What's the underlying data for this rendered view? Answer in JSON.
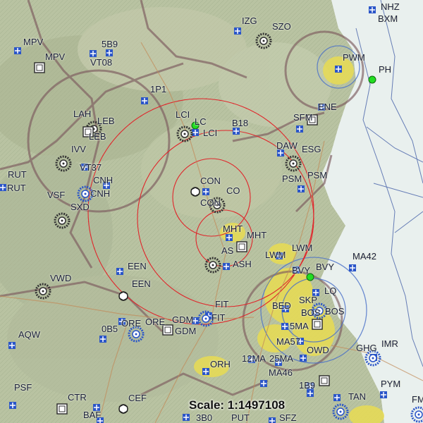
{
  "scale_text": "Scale: 1:1497108",
  "colors": {
    "terrain": "#b9c3a2",
    "water": "#e9f0ee",
    "range_rings": "#e0262b",
    "airspace": "#7c5a5e",
    "airport_blue": "#2a55c8",
    "waypoint_green": "#22dd22",
    "urban": "#e8dc52"
  },
  "airports": [
    {
      "id": "mpv",
      "symbol": "towered-airport-icon",
      "label": "MPV"
    },
    {
      "id": "5b9",
      "symbol": "towered-airport-icon",
      "label": "5B9"
    },
    {
      "id": "vt08",
      "symbol": "towered-airport-icon",
      "label": "VT08"
    },
    {
      "id": "1p1",
      "symbol": "towered-airport-icon",
      "label": "1P1"
    },
    {
      "id": "izg",
      "symbol": "towered-airport-icon",
      "label": "IZG"
    },
    {
      "id": "nhz",
      "symbol": "towered-airport-icon",
      "label": "NHZ"
    },
    {
      "id": "pwm",
      "symbol": "towered-airport-icon",
      "label": "PWM"
    },
    {
      "id": "b18",
      "symbol": "towered-airport-icon",
      "label": "B18"
    },
    {
      "id": "lci",
      "symbol": "towered-airport-icon",
      "label": "LCI"
    },
    {
      "id": "sfm",
      "symbol": "towered-airport-icon",
      "label": "SFM"
    },
    {
      "id": "dawesg",
      "symbol": "towered-airport-icon",
      "label": "ESG"
    },
    {
      "id": "vt37",
      "symbol": "towered-airport-icon",
      "label": "VT37"
    },
    {
      "id": "cnh",
      "symbol": "towered-airport-icon",
      "label": "CNH"
    },
    {
      "id": "rut",
      "symbol": "towered-airport-icon",
      "label": "RUT"
    },
    {
      "id": "con",
      "symbol": "towered-airport-icon",
      "label": "CON"
    },
    {
      "id": "psm",
      "symbol": "towered-airport-icon",
      "label": "PSM"
    },
    {
      "id": "mht",
      "symbol": "towered-airport-icon",
      "label": "MHT"
    },
    {
      "id": "ash",
      "symbol": "towered-airport-icon",
      "label": "ASH"
    },
    {
      "id": "lwm",
      "symbol": "towered-airport-icon",
      "label": "LWM"
    },
    {
      "id": "ma42",
      "symbol": "towered-airport-icon",
      "label": "MA42"
    },
    {
      "id": "bvy",
      "symbol": "towered-airport-icon",
      "label": "BVY"
    },
    {
      "id": "een",
      "symbol": "towered-airport-icon",
      "label": "EEN"
    },
    {
      "id": "fit",
      "symbol": "towered-airport-icon",
      "label": "FIT"
    },
    {
      "id": "gdm",
      "symbol": "towered-airport-icon",
      "label": "GDM"
    },
    {
      "id": "ore",
      "symbol": "towered-airport-icon",
      "label": "ORE"
    },
    {
      "id": "0b5",
      "symbol": "towered-airport-icon",
      "label": "0B5"
    },
    {
      "id": "aqw",
      "symbol": "towered-airport-icon",
      "label": "AQW"
    },
    {
      "id": "orh",
      "symbol": "towered-airport-icon",
      "label": "ORH"
    },
    {
      "id": "ma57",
      "symbol": "towered-airport-icon",
      "label": "MA57"
    },
    {
      "id": "5ma",
      "symbol": "towered-airport-icon",
      "label": "5MA"
    },
    {
      "id": "owd",
      "symbol": "towered-airport-icon",
      "label": "OWD"
    },
    {
      "id": "12ma",
      "symbol": "towered-airport-icon",
      "label": "12MA"
    },
    {
      "id": "25ma",
      "symbol": "towered-airport-icon",
      "label": "25MA"
    },
    {
      "id": "ma46",
      "symbol": "towered-airport-icon",
      "label": "MA46"
    },
    {
      "id": "bos",
      "symbol": "towered-airport-icon",
      "label": "BOS"
    },
    {
      "id": "bed",
      "symbol": "towered-airport-icon",
      "label": "BED"
    },
    {
      "id": "psf",
      "symbol": "towered-airport-icon",
      "label": "PSF"
    },
    {
      "id": "ctr",
      "symbol": "towered-airport-icon",
      "label": "CTR"
    },
    {
      "id": "baf",
      "symbol": "towered-airport-icon",
      "label": "BAF"
    },
    {
      "id": "3b0",
      "symbol": "towered-airport-icon",
      "label": "3B0"
    },
    {
      "id": "put",
      "symbol": "towered-airport-icon",
      "label": "PUT"
    },
    {
      "id": "sfz",
      "symbol": "towered-airport-icon",
      "label": "SFZ"
    },
    {
      "id": "1b9",
      "symbol": "towered-airport-icon",
      "label": "1B9"
    },
    {
      "id": "tan",
      "symbol": "towered-airport-icon",
      "label": "TAN"
    },
    {
      "id": "pym",
      "symbol": "towered-airport-icon",
      "label": "PYM"
    },
    {
      "id": "imr",
      "symbol": "towered-airport-icon",
      "label": "IMR"
    },
    {
      "id": "ghg",
      "symbol": "towered-airport-icon",
      "label": "GHG"
    },
    {
      "id": "lq",
      "symbol": "towered-airport-icon",
      "label": "LQ"
    },
    {
      "id": "fm",
      "symbol": "towered-airport-icon",
      "label": "FM"
    }
  ],
  "labels": [
    {
      "id": "mpv1",
      "text": "MPV"
    },
    {
      "id": "mpv2",
      "text": "MPV"
    },
    {
      "id": "5b9",
      "text": "5B9"
    },
    {
      "id": "vt08",
      "text": "VT08"
    },
    {
      "id": "1p1",
      "text": "1P1"
    },
    {
      "id": "izg",
      "text": "IZG"
    },
    {
      "id": "szo",
      "text": "SZO"
    },
    {
      "id": "nhz",
      "text": "NHZ"
    },
    {
      "id": "bxm",
      "text": "BXM"
    },
    {
      "id": "pwm",
      "text": "PWM"
    },
    {
      "id": "ph",
      "text": "PH"
    },
    {
      "id": "lah",
      "text": "LAH"
    },
    {
      "id": "leb1",
      "text": "LEB"
    },
    {
      "id": "leb2",
      "text": "LEB"
    },
    {
      "id": "lci1",
      "text": "LCI"
    },
    {
      "id": "lc",
      "text": "LC"
    },
    {
      "id": "lci2",
      "text": "LCI"
    },
    {
      "id": "b18",
      "text": "B18"
    },
    {
      "id": "sfm",
      "text": "SFM"
    },
    {
      "id": "ene",
      "text": "ENE"
    },
    {
      "id": "ivv",
      "text": "IVV"
    },
    {
      "id": "daw",
      "text": "DAW"
    },
    {
      "id": "esg",
      "text": "ESG"
    },
    {
      "id": "vt37",
      "text": "VT37"
    },
    {
      "id": "rut1",
      "text": "RUT"
    },
    {
      "id": "rut2",
      "text": "RUT"
    },
    {
      "id": "cnh1",
      "text": "CNH"
    },
    {
      "id": "cnh2",
      "text": "CNH"
    },
    {
      "id": "vsf",
      "text": "VSF"
    },
    {
      "id": "sxd",
      "text": "SXD"
    },
    {
      "id": "con1",
      "text": "CON"
    },
    {
      "id": "co",
      "text": "CO"
    },
    {
      "id": "con2",
      "text": "CON"
    },
    {
      "id": "psm1",
      "text": "PSM"
    },
    {
      "id": "psm2",
      "text": "PSM"
    },
    {
      "id": "mht1",
      "text": "MHT"
    },
    {
      "id": "mht2",
      "text": "MHT"
    },
    {
      "id": "as",
      "text": "AS"
    },
    {
      "id": "lwm1",
      "text": "LWM"
    },
    {
      "id": "lwm2",
      "text": "LWM"
    },
    {
      "id": "ash",
      "text": "ASH"
    },
    {
      "id": "ma42",
      "text": "MA42"
    },
    {
      "id": "bvy1",
      "text": "BVY"
    },
    {
      "id": "bvy2",
      "text": "BVY"
    },
    {
      "id": "een1",
      "text": "EEN"
    },
    {
      "id": "een2",
      "text": "EEN"
    },
    {
      "id": "vwd",
      "text": "VWD"
    },
    {
      "id": "lq",
      "text": "LQ"
    },
    {
      "id": "skp",
      "text": "SKP"
    },
    {
      "id": "bed",
      "text": "BED"
    },
    {
      "id": "bos1",
      "text": "BOS"
    },
    {
      "id": "bos2",
      "text": "BOS"
    },
    {
      "id": "fit1",
      "text": "FIT"
    },
    {
      "id": "fit2",
      "text": "FIT"
    },
    {
      "id": "ore1",
      "text": "ORE"
    },
    {
      "id": "ore2",
      "text": "ORE"
    },
    {
      "id": "gdm1",
      "text": "GDM"
    },
    {
      "id": "gdm2",
      "text": "GDM"
    },
    {
      "id": "0b5",
      "text": "0B5"
    },
    {
      "id": "5ma",
      "text": "5MA"
    },
    {
      "id": "ma57",
      "text": "MA57"
    },
    {
      "id": "aqw",
      "text": "AQW"
    },
    {
      "id": "owd",
      "text": "OWD"
    },
    {
      "id": "ghg",
      "text": "GHG"
    },
    {
      "id": "imr",
      "text": "IMR"
    },
    {
      "id": "orh",
      "text": "ORH"
    },
    {
      "id": "12ma",
      "text": "12MA"
    },
    {
      "id": "25ma",
      "text": "25MA"
    },
    {
      "id": "ma46",
      "text": "MA46"
    },
    {
      "id": "psf",
      "text": "PSF"
    },
    {
      "id": "1b9",
      "text": "1B9"
    },
    {
      "id": "pym",
      "text": "PYM"
    },
    {
      "id": "ctr",
      "text": "CTR"
    },
    {
      "id": "cef",
      "text": "CEF"
    },
    {
      "id": "tan",
      "text": "TAN"
    },
    {
      "id": "baf",
      "text": "BAF"
    },
    {
      "id": "3b0",
      "text": "3B0"
    },
    {
      "id": "put",
      "text": "PUT"
    },
    {
      "id": "sfz",
      "text": "SFZ"
    },
    {
      "id": "fm",
      "text": "FM"
    }
  ]
}
